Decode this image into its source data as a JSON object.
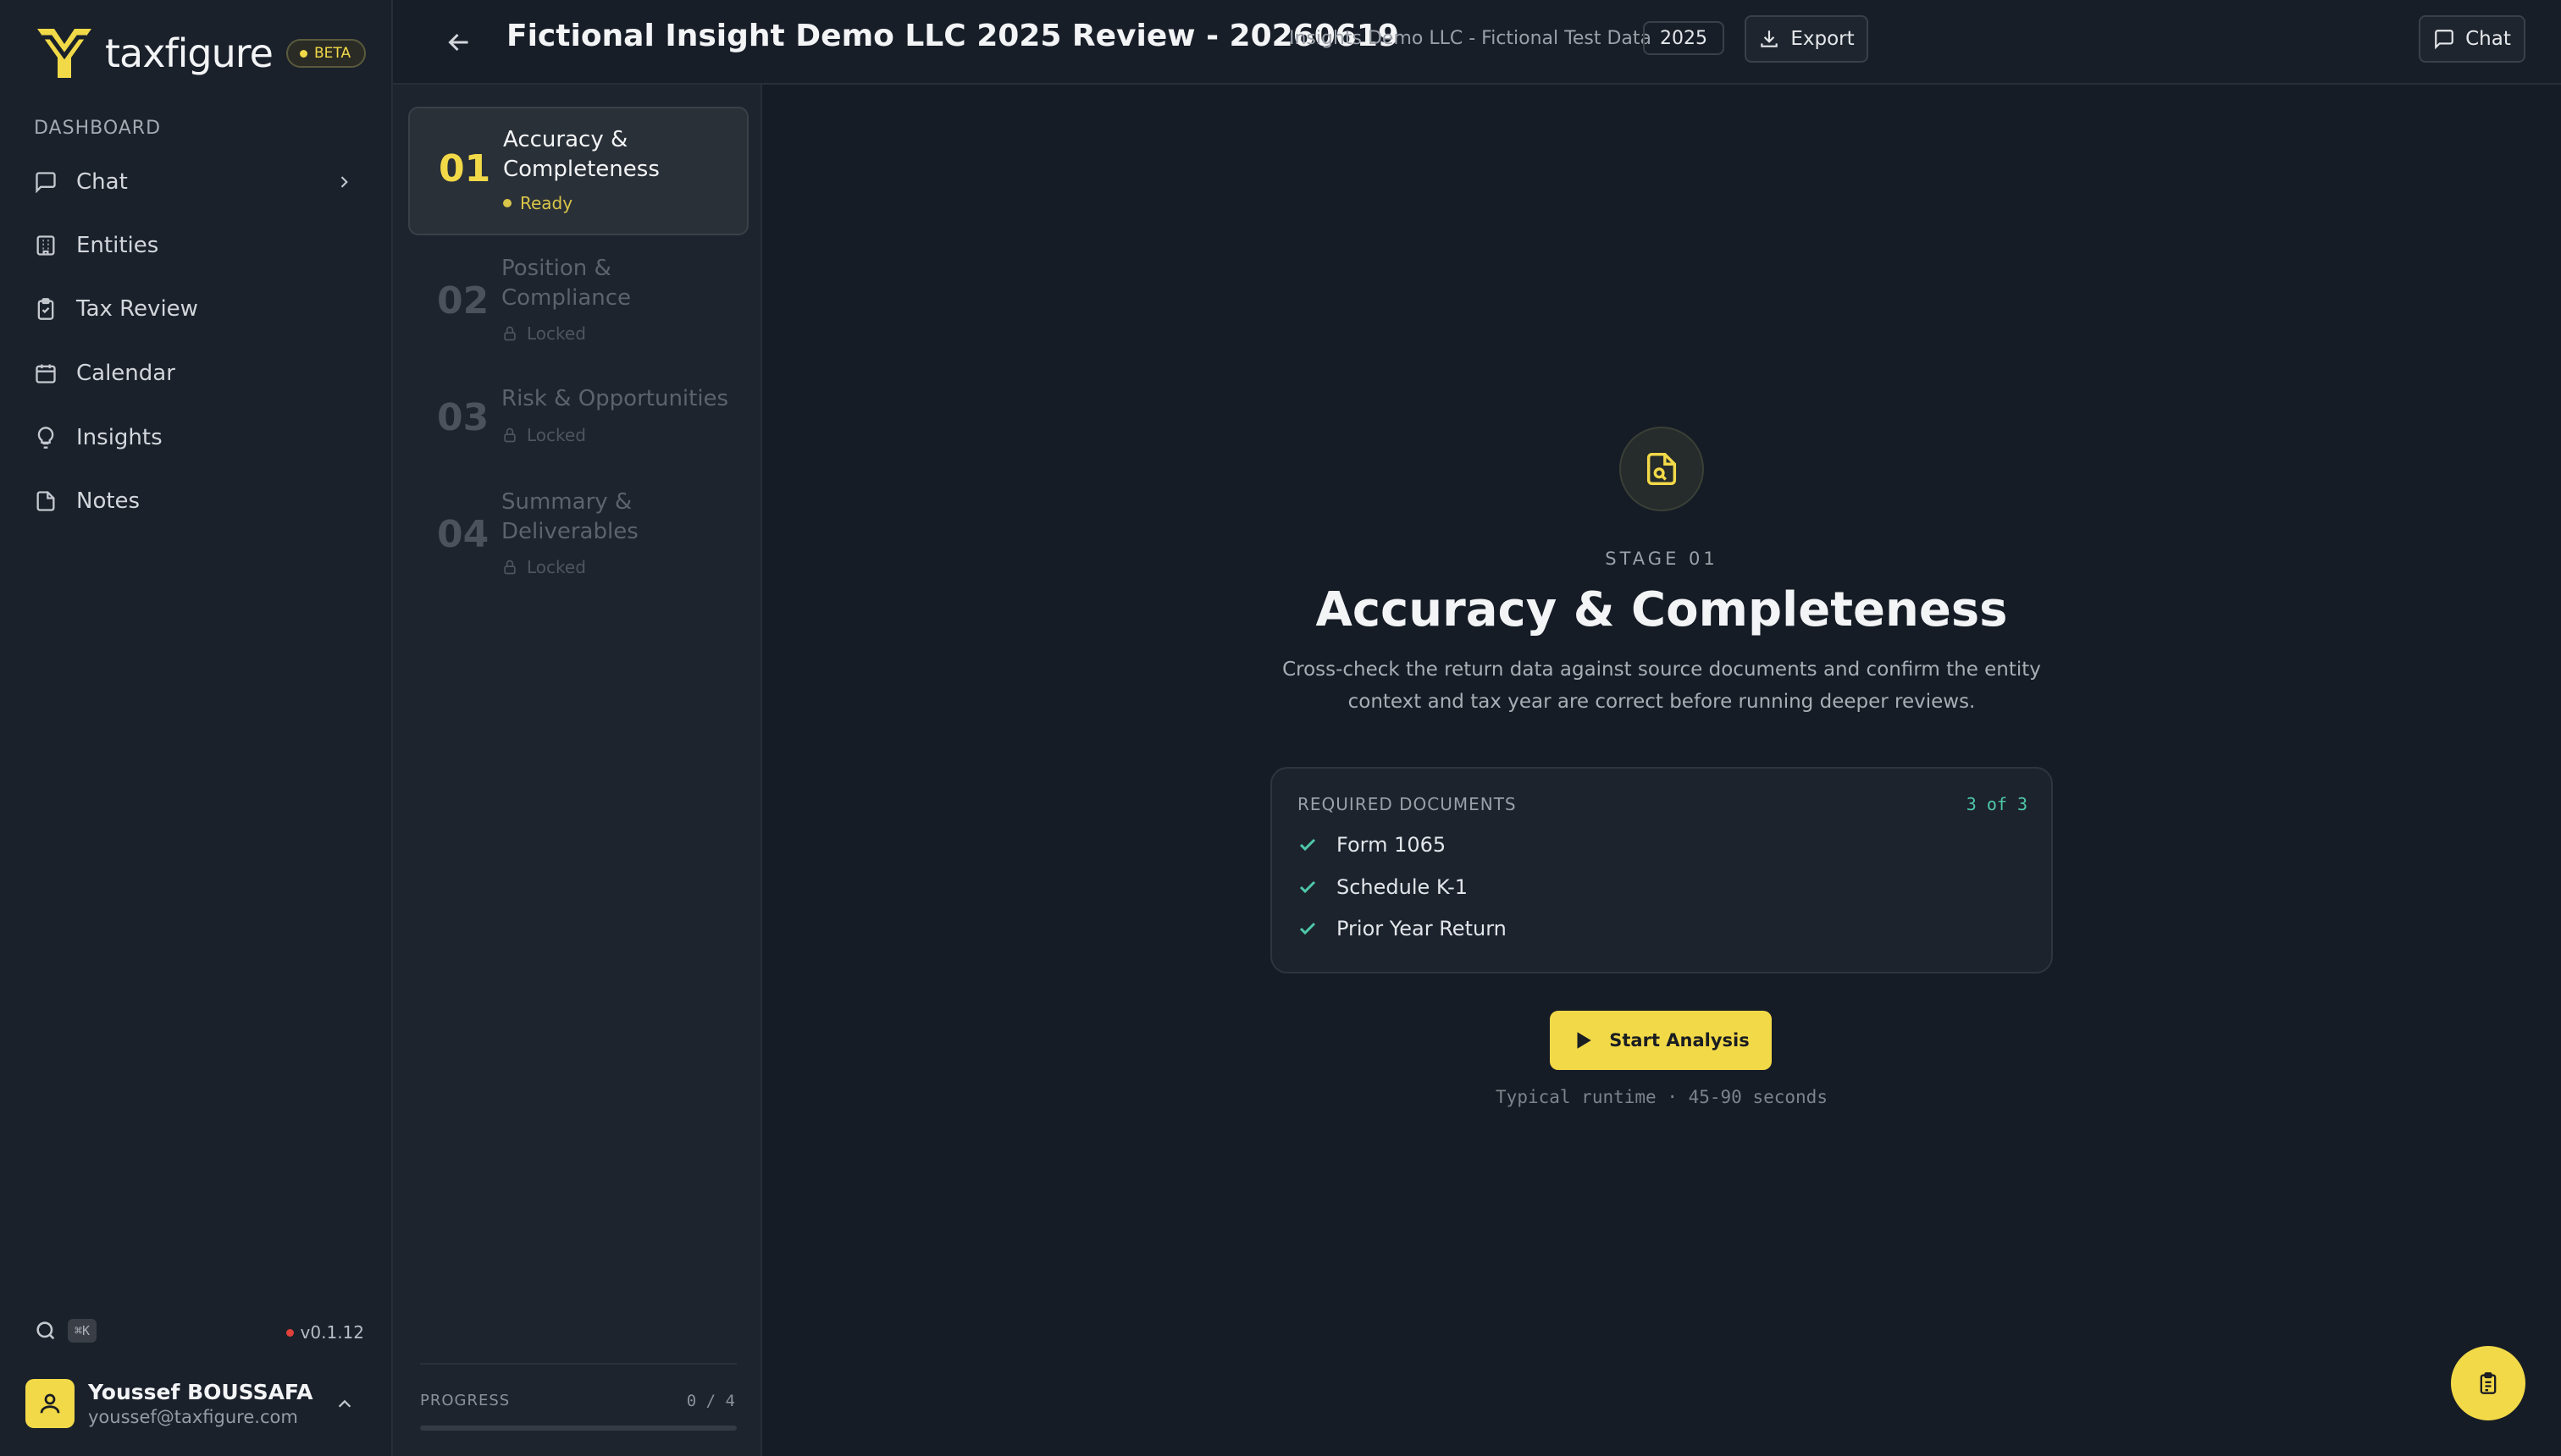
{
  "app": {
    "brand": "taxfigure",
    "beta_label": "BETA",
    "accent_color": "#f2d948"
  },
  "sidebar": {
    "section_label": "DASHBOARD",
    "items": [
      {
        "label": "Chat",
        "icon": "message-square-icon"
      },
      {
        "label": "Entities",
        "icon": "building-icon"
      },
      {
        "label": "Tax Review",
        "icon": "clipboard-check-icon"
      },
      {
        "label": "Calendar",
        "icon": "calendar-icon"
      },
      {
        "label": "Insights",
        "icon": "lightbulb-icon"
      },
      {
        "label": "Notes",
        "icon": "file-icon"
      }
    ],
    "search_shortcut": "⌘K",
    "version": "v0.1.12",
    "user": {
      "name": "Youssef BOUSSAFA",
      "email": "youssef@taxfigure.com"
    }
  },
  "header": {
    "title": "Fictional Insight Demo LLC 2025 Review - 20260619",
    "subtitle": "Insights Demo LLC - Fictional Test Data",
    "year": "2025",
    "export_label": "Export",
    "chat_label": "Chat"
  },
  "stages": [
    {
      "num": "01",
      "title": "Accuracy & Completeness",
      "status": "Ready",
      "active": true
    },
    {
      "num": "02",
      "title": "Position & Compliance",
      "status": "Locked",
      "active": false
    },
    {
      "num": "03",
      "title": "Risk & Opportunities",
      "status": "Locked",
      "active": false
    },
    {
      "num": "04",
      "title": "Summary & Deliverables",
      "status": "Locked",
      "active": false
    }
  ],
  "progress": {
    "label": "PROGRESS",
    "count": "0 / 4",
    "fraction": 0
  },
  "main": {
    "eyebrow": "STAGE 01",
    "heading": "Accuracy & Completeness",
    "description": "Cross-check the return data against source documents and confirm the entity context and tax year are correct before running deeper reviews.",
    "docs_title": "REQUIRED DOCUMENTS",
    "docs_count": "3 of 3",
    "documents": [
      "Form 1065",
      "Schedule K-1",
      "Prior Year Return"
    ],
    "start_label": "Start Analysis",
    "runtime_note": "Typical runtime · 45-90 seconds"
  }
}
